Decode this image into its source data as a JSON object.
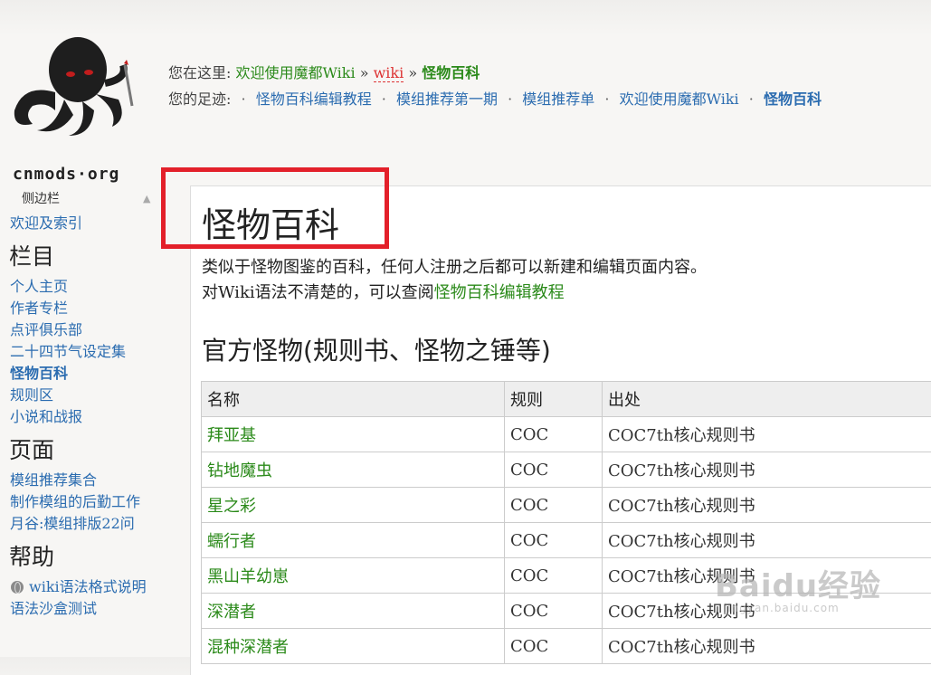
{
  "logo": {
    "text": "cnmods·org"
  },
  "breadcrumb": {
    "label": "您在这里:",
    "items": [
      "欢迎使用魔都Wiki",
      "wiki",
      "怪物百科"
    ],
    "separator": "»"
  },
  "trace": {
    "label": "您的足迹:",
    "items": [
      "怪物百科编辑教程",
      "模组推荐第一期",
      "模组推荐单",
      "欢迎使用魔都Wiki",
      "怪物百科"
    ]
  },
  "sidebar": {
    "header": "侧边栏",
    "top_link": "欢迎及索引",
    "sections": [
      {
        "title": "栏目",
        "items": [
          "个人主页",
          "作者专栏",
          "点评俱乐部",
          "二十四节气设定集",
          "怪物百科",
          "规则区",
          "小说和战报"
        ]
      },
      {
        "title": "页面",
        "items": [
          "模组推荐集合",
          "制作模组的后勤工作",
          "月谷:模组排版22问"
        ]
      },
      {
        "title": "帮助",
        "items": [
          "wiki语法格式说明",
          "语法沙盒测试"
        ]
      }
    ]
  },
  "main": {
    "title": "怪物百科",
    "intro_line1": "类似于怪物图鉴的百科，任何人注册之后都可以新建和编辑页面内容。",
    "intro_line2_prefix": "对Wiki语法不清楚的，可以查阅",
    "intro_line2_link": "怪物百科编辑教程",
    "section_title": "官方怪物(规则书、怪物之锤等)",
    "table": {
      "headers": [
        "名称",
        "规则",
        "出处"
      ],
      "rows": [
        [
          "拜亚基",
          "COC",
          "COC7th核心规则书"
        ],
        [
          "钻地魔虫",
          "COC",
          "COC7th核心规则书"
        ],
        [
          "星之彩",
          "COC",
          "COC7th核心规则书"
        ],
        [
          "蠕行者",
          "COC",
          "COC7th核心规则书"
        ],
        [
          "黑山羊幼崽",
          "COC",
          "COC7th核心规则书"
        ],
        [
          "深潜者",
          "COC",
          "COC7th核心规则书"
        ],
        [
          "混种深潜者",
          "COC",
          "COC7th核心规则书"
        ]
      ]
    }
  },
  "watermark": {
    "main": "Baidu经验",
    "sub": "jingyan.baidu.com"
  },
  "colors": {
    "link_green": "#2b8a1a",
    "link_blue": "#2b6cb0",
    "highlight": "#e3202a"
  }
}
